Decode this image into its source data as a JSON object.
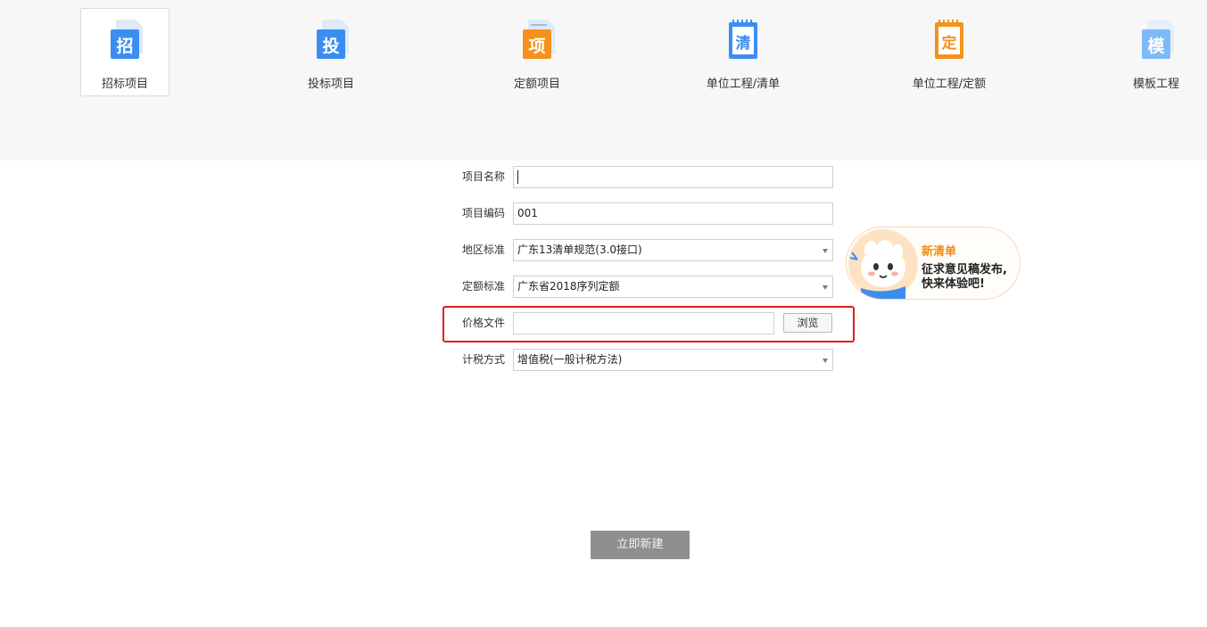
{
  "toolbar": {
    "items": [
      {
        "label": "招标项目",
        "glyph": "招",
        "icon": "bidding-doc-icon",
        "color": "#3b8ef0",
        "active": true
      },
      {
        "label": "投标项目",
        "glyph": "投",
        "icon": "tender-doc-icon",
        "color": "#3b8ef0"
      },
      {
        "label": "定额项目",
        "glyph": "项",
        "icon": "quota-project-icon",
        "color": "#f5921e"
      },
      {
        "label": "单位工程/清单",
        "glyph": "清",
        "icon": "bill-notebook-icon",
        "color": "#3b8ef0"
      },
      {
        "label": "单位工程/定额",
        "glyph": "定",
        "icon": "quota-notebook-icon",
        "color": "#f5921e"
      },
      {
        "label": "模板工程",
        "glyph": "模",
        "icon": "template-doc-icon",
        "color": "#7fb9f7"
      }
    ]
  },
  "form": {
    "project_name": {
      "label": "项目名称",
      "value": ""
    },
    "project_code": {
      "label": "项目编码",
      "value": "001"
    },
    "region_standard": {
      "label": "地区标准",
      "value": "广东13清单规范(3.0接口)"
    },
    "quota_standard": {
      "label": "定额标准",
      "value": "广东省2018序列定额"
    },
    "price_file": {
      "label": "价格文件",
      "value": "",
      "browse_label": "浏览"
    },
    "tax_method": {
      "label": "计税方式",
      "value": "增值税(一般计税方法)"
    }
  },
  "promo": {
    "title": "新清单",
    "line1": "征求意见稿发布,",
    "line2": "快来体验吧!",
    "mascot_icon": "mascot-icon"
  },
  "create_button": {
    "label": "立即新建"
  },
  "colors": {
    "toolbar_bg": "#f7f7f7",
    "blue_icon": "#3b8ef0",
    "orange_icon": "#f5921e",
    "highlight": "#e02020",
    "promo_accent": "#f08a12",
    "button_bg": "#8f8f8f"
  }
}
